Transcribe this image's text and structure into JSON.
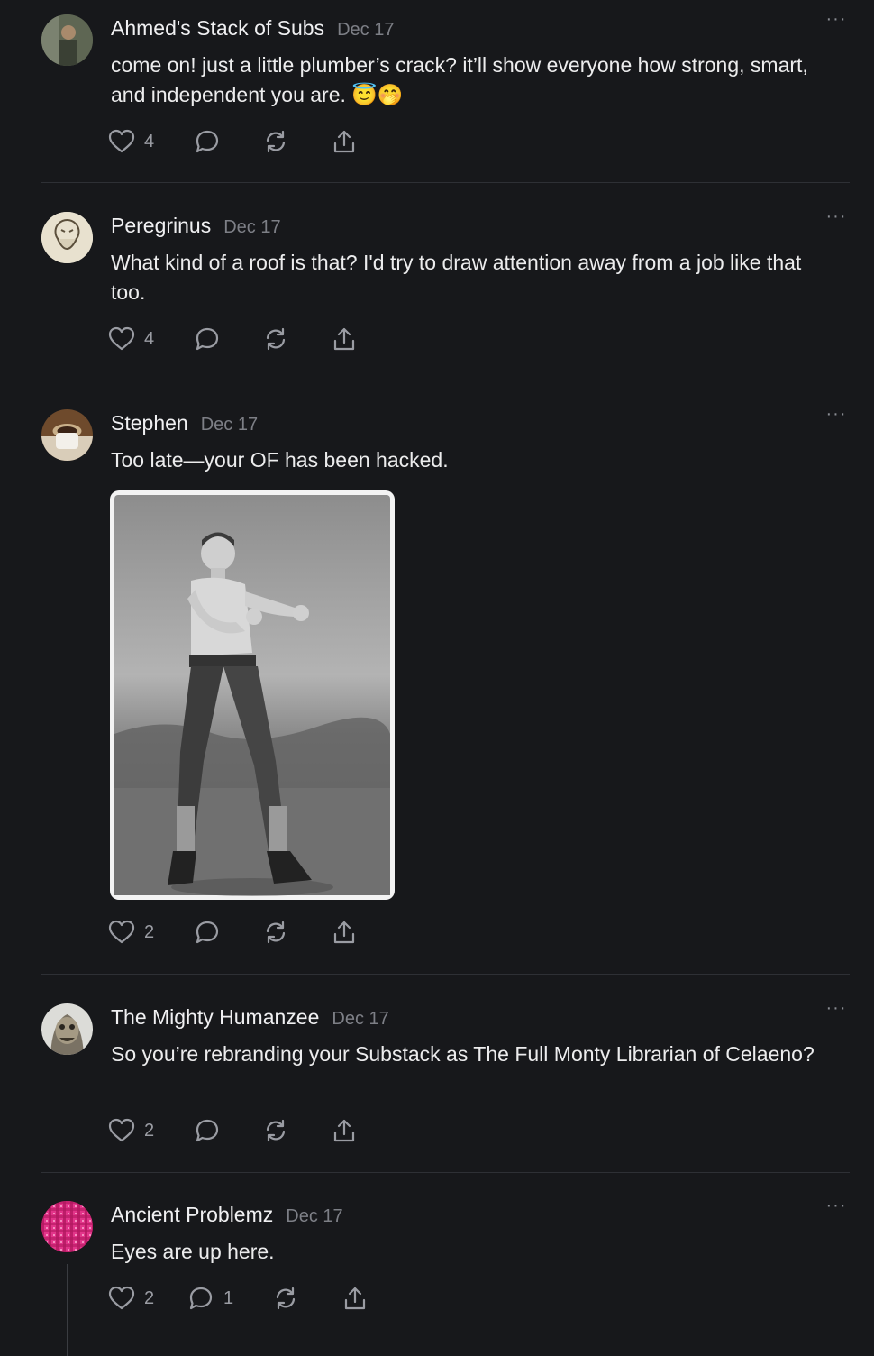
{
  "comments": [
    {
      "author": "Ahmed's Stack of Subs",
      "date": "Dec 17",
      "text": "come on! just a little plumber’s crack? it’ll show everyone how strong, smart, and independent you are. 😇🤭",
      "likes": "4",
      "replies": "",
      "avatar": "avatar-photo-man-outdoors"
    },
    {
      "author": "Peregrinus",
      "date": "Dec 17",
      "text": "What kind of a roof is that? I'd try to draw attention away from a job like that too.",
      "likes": "4",
      "replies": "",
      "avatar": "avatar-icon-illustration"
    },
    {
      "author": "Stephen",
      "date": "Dec 17",
      "text": "Too late—your OF has been hacked.",
      "likes": "2",
      "replies": "",
      "avatar": "avatar-photo-coffee",
      "image": "vintage-boxer-photo"
    },
    {
      "author": "The Mighty Humanzee",
      "date": "Dec 17",
      "text": "So you’re rebranding your Substack as The Full Monty Librarian of Celaeno?",
      "likes": "2",
      "replies": "",
      "avatar": "avatar-creature-face"
    },
    {
      "author": "Ancient Problemz",
      "date": "Dec 17",
      "text": "Eyes are up here.",
      "likes": "2",
      "replies": "1",
      "avatar": "avatar-pink-plaid"
    }
  ],
  "ui": {
    "more_glyph": "···",
    "icons": [
      "heart-icon",
      "comment-icon",
      "restack-icon",
      "share-icon",
      "more-icon"
    ],
    "colors": {
      "background": "#17181b",
      "text": "#ececed",
      "muted": "#7d7f86",
      "divider": "#2e3035"
    }
  }
}
